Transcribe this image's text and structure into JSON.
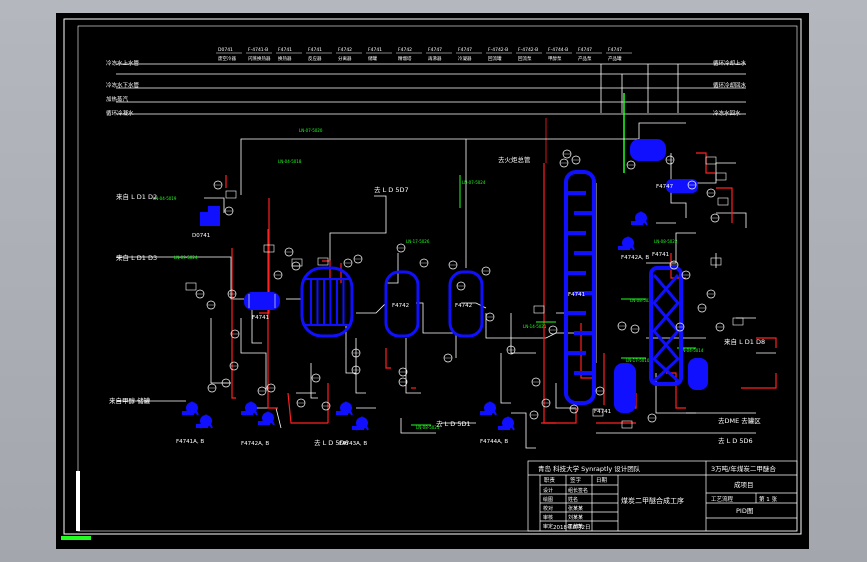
{
  "colors": {
    "background": "#000000",
    "line_white": "#ffffff",
    "equipment": "#1010ff",
    "instrument_red": "#ff2020",
    "signal_green": "#20ff20",
    "canvas_bg": "#a9adb4"
  },
  "header_tags": [
    {
      "tag": "D0741",
      "name": "废空冷器"
    },
    {
      "tag": "F-4741·B",
      "name": "闪蒸换热器"
    },
    {
      "tag": "F4741",
      "name": "换热器"
    },
    {
      "tag": "F4741",
      "name": "反应器"
    },
    {
      "tag": "F4742",
      "name": "分离器"
    },
    {
      "tag": "F4741",
      "name": "储罐"
    },
    {
      "tag": "F4742",
      "name": "精馏塔"
    },
    {
      "tag": "F4747",
      "name": "再沸器"
    },
    {
      "tag": "F4747",
      "name": "冷凝器"
    },
    {
      "tag": "F-4742·B",
      "name": "回流罐"
    },
    {
      "tag": "F-4742·B",
      "name": "回流泵"
    },
    {
      "tag": "F-4744·B",
      "name": "甲醇泵"
    },
    {
      "tag": "F4747",
      "name": "产品泵"
    },
    {
      "tag": "F4747",
      "name": "产品罐"
    }
  ],
  "utility_lines": {
    "left": [
      "冷冻水上水管",
      "冷冻水下水管",
      "加热蒸汽",
      "循环冷凝水"
    ],
    "right": [
      "循环冷却上水",
      "循环冷却回水",
      "冷冻水回水"
    ]
  },
  "stream_labels": {
    "feed_1": "来自 L D1 D2",
    "feed_2": "来自 L D1 D3",
    "feed_methanol": "来自甲醇 储罐",
    "to_d5": "去 L D 5D7",
    "to_d5_2": "去 L D 5D1",
    "to_d6": "去 L D 5D6",
    "to_dme": "去DME 去罐区",
    "to_d5_3": "去 L D 5D6",
    "from_d1": "来自 L D1 D8",
    "steam_in": "去火炬总管"
  },
  "equipment_tags": {
    "d0741": "D0741",
    "e4741": "F4741",
    "r4741": "F4741",
    "v4742a": "F4742",
    "v4742b": "F4742",
    "column": "F4741",
    "column_low": "F4741",
    "reboiler": "F4741",
    "p_a": "F4741A, B",
    "p_b": "F4742A, B",
    "p_c": "F4743A, B",
    "p_d": "F4744A, B",
    "p_e": "F4742A, B",
    "p_f": "F4747"
  },
  "title_block": {
    "school": "青岛 科技大学 Synraptly 设计团队",
    "project_line1": "3万吨/年煤炭二甲醚合",
    "project_line2": "成项目",
    "drawing_title": "煤炭二甲醚合成工序",
    "drawing_type": "PID图",
    "row_labels": [
      "设计",
      "绘图",
      "校对",
      "审核",
      "审定"
    ],
    "row_names": [
      "组长签名",
      "姓名",
      "张某某",
      "刘某某",
      "王某某"
    ],
    "col_headers": [
      "职责",
      "签字",
      "日期"
    ],
    "fill_text": "工艺流程",
    "scale_label": "比例",
    "sheet_label": "第 1 张",
    "date": "2018年6月2日"
  },
  "green_labels": [
    "LN-07-5020",
    "LN-04-5018",
    "LN-04-5019",
    "LN-17-5026",
    "LN-09-5024",
    "LN-07-5024",
    "LN-14-5021",
    "LN-08-5021",
    "LN-17-5010",
    "LN-04-5014",
    "LN-08-5025",
    "LN-08-5022"
  ]
}
